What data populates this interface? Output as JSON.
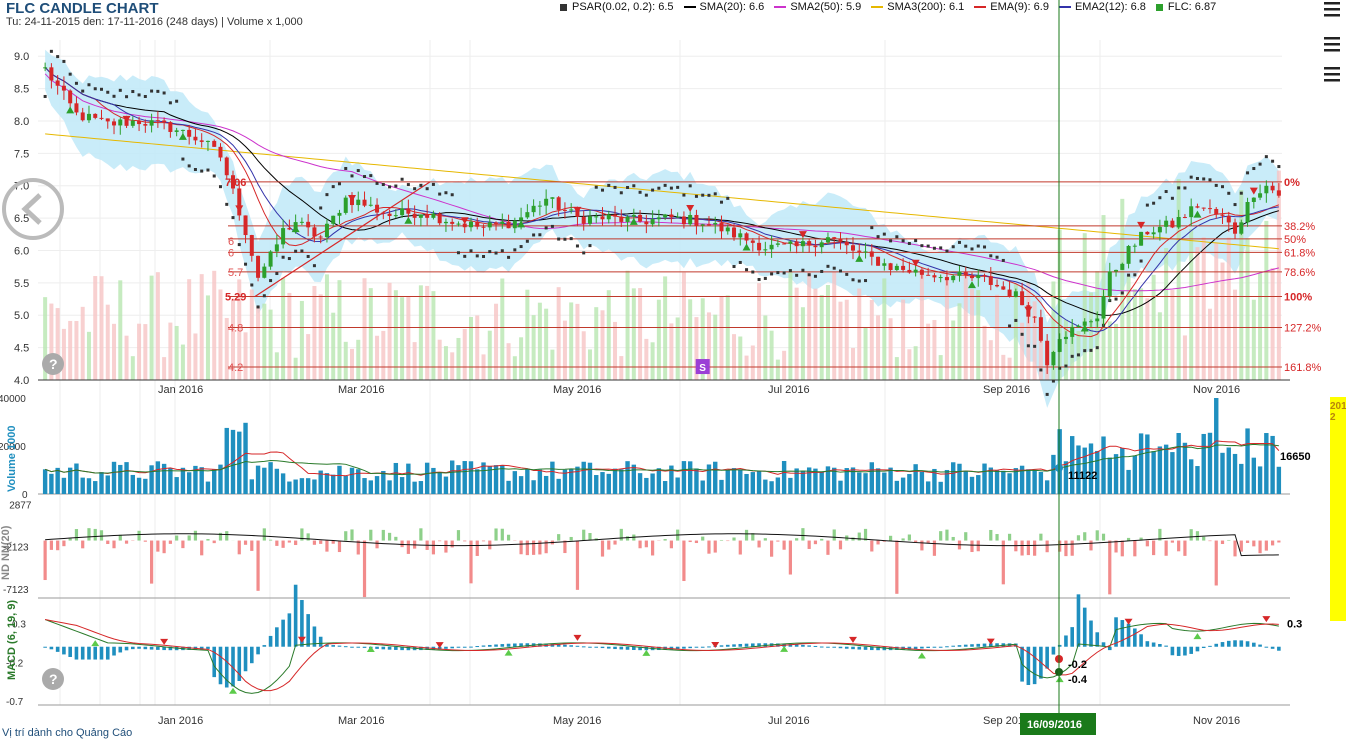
{
  "header": {
    "title": "FLC CANDLE CHART",
    "subtitle": "Tu: 24-11-2015 den: 17-11-2016 (248 days) | Volume x 1,000"
  },
  "legend": [
    {
      "label": "PSAR(0.02, 0.2): 6.5",
      "color": "#333333",
      "shape": "square"
    },
    {
      "label": "SMA(20): 6.6",
      "color": "#000000",
      "shape": "line"
    },
    {
      "label": "SMA2(50): 5.9",
      "color": "#cc33cc",
      "shape": "line"
    },
    {
      "label": "SMA3(200): 6.1",
      "color": "#e6b800",
      "shape": "line"
    },
    {
      "label": "EMA(9): 6.9",
      "color": "#d62728",
      "shape": "line"
    },
    {
      "label": "EMA2(12): 6.8",
      "color": "#3333aa",
      "shape": "line"
    },
    {
      "label": "FLC: 6.87",
      "color": "#2ca02c",
      "shape": "square"
    }
  ],
  "footer": {
    "ads_text": "Vị trí dành cho Quảng Cáo"
  },
  "icons": {
    "menu": "hamburger-menu-icon",
    "back": "back-arrow-circle-icon",
    "help": "help-circle-icon"
  },
  "colors": {
    "up": "#2ca02c",
    "down": "#d62728",
    "volume": "#1f8fbf",
    "band": "#bfe9f8",
    "cursor": "#1a7a1a"
  },
  "chart_data": [
    {
      "type": "candlestick",
      "name": "price",
      "ylim": [
        4.0,
        9.25
      ],
      "yticks": [
        "9.0",
        "8.5",
        "8.0",
        "7.5",
        "7.0",
        "6.5",
        "6.0",
        "5.5",
        "5.0",
        "4.5",
        "4.0"
      ],
      "month_labels": [
        "Jan 2016",
        "Mar 2016",
        "May 2016",
        "Jul 2016",
        "Sep 2016",
        "Nov 2016"
      ],
      "fibonacci": {
        "high": 7.06,
        "low": 5.29,
        "high_label": "7.06",
        "low_label": "5.29",
        "levels": [
          {
            "pct": "0%",
            "value": 7.06
          },
          {
            "pct": "38.2%",
            "value": 6.38
          },
          {
            "pct": "50%",
            "value": 6.18
          },
          {
            "pct": "61.8%",
            "value": 5.97
          },
          {
            "pct": "78.6%",
            "value": 5.67
          },
          {
            "pct": "100%",
            "value": 5.29
          },
          {
            "pct": "127.2%",
            "value": 4.81
          },
          {
            "pct": "161.8%",
            "value": 4.2
          }
        ],
        "left_labels": [
          "6",
          "6",
          "5.7",
          "4.8",
          "4.2"
        ]
      },
      "close_trace": [
        [
          0,
          8.8
        ],
        [
          5,
          8.1
        ],
        [
          10,
          7.95
        ],
        [
          15,
          8.0
        ],
        [
          20,
          7.9
        ],
        [
          25,
          7.7
        ],
        [
          28,
          7.45
        ],
        [
          30,
          6.9
        ],
        [
          32,
          6.3
        ],
        [
          34,
          5.6
        ],
        [
          36,
          5.9
        ],
        [
          38,
          6.3
        ],
        [
          40,
          6.45
        ],
        [
          42,
          6.3
        ],
        [
          44,
          6.2
        ],
        [
          46,
          6.5
        ],
        [
          48,
          6.8
        ],
        [
          50,
          6.75
        ],
        [
          55,
          6.55
        ],
        [
          60,
          6.6
        ],
        [
          65,
          6.45
        ],
        [
          70,
          6.35
        ],
        [
          75,
          6.45
        ],
        [
          80,
          6.8
        ],
        [
          85,
          6.5
        ],
        [
          90,
          6.5
        ],
        [
          95,
          6.45
        ],
        [
          100,
          6.5
        ],
        [
          105,
          6.45
        ],
        [
          110,
          6.25
        ],
        [
          115,
          6.05
        ],
        [
          120,
          6.05
        ],
        [
          125,
          6.2
        ],
        [
          130,
          5.95
        ],
        [
          135,
          5.75
        ],
        [
          140,
          5.65
        ],
        [
          145,
          5.6
        ],
        [
          150,
          5.55
        ],
        [
          155,
          5.3
        ],
        [
          158,
          4.95
        ],
        [
          160,
          4.3
        ],
        [
          162,
          4.7
        ],
        [
          165,
          4.8
        ],
        [
          168,
          5.0
        ],
        [
          170,
          5.6
        ],
        [
          173,
          6.0
        ],
        [
          176,
          6.3
        ],
        [
          180,
          6.4
        ],
        [
          184,
          6.7
        ],
        [
          186,
          6.6
        ],
        [
          188,
          6.5
        ],
        [
          190,
          6.3
        ],
        [
          193,
          6.9
        ],
        [
          195,
          7.0
        ],
        [
          197,
          6.87
        ]
      ],
      "annotations": [
        {
          "label": "S",
          "date_index": 105,
          "value": 4.2
        }
      ]
    },
    {
      "type": "bar",
      "name": "volume",
      "ylabel": "Volume 1000",
      "yticks": [
        "40000",
        "20000",
        "0"
      ],
      "ylim": [
        0,
        40000
      ],
      "last_value": "16650",
      "cursor_value": "11122"
    },
    {
      "type": "bar",
      "name": "net-foreign-flow",
      "ylabel": "ND NN(20)",
      "yticks": [
        "2877",
        "-2123",
        "-7123"
      ],
      "ylim": [
        -8200,
        3400
      ]
    },
    {
      "type": "line",
      "name": "macd",
      "ylabel": "MACD (6, 19, 9)",
      "yticks": [
        "0.3",
        "-0.2",
        "-0.7"
      ],
      "ylim": [
        -0.75,
        0.55
      ],
      "last_value": "0.3",
      "cursor_values": [
        "-0.2",
        "-0.4"
      ]
    }
  ],
  "cursor": {
    "date_label": "16/09/2016"
  },
  "side_labels": [
    "2016",
    "2"
  ]
}
